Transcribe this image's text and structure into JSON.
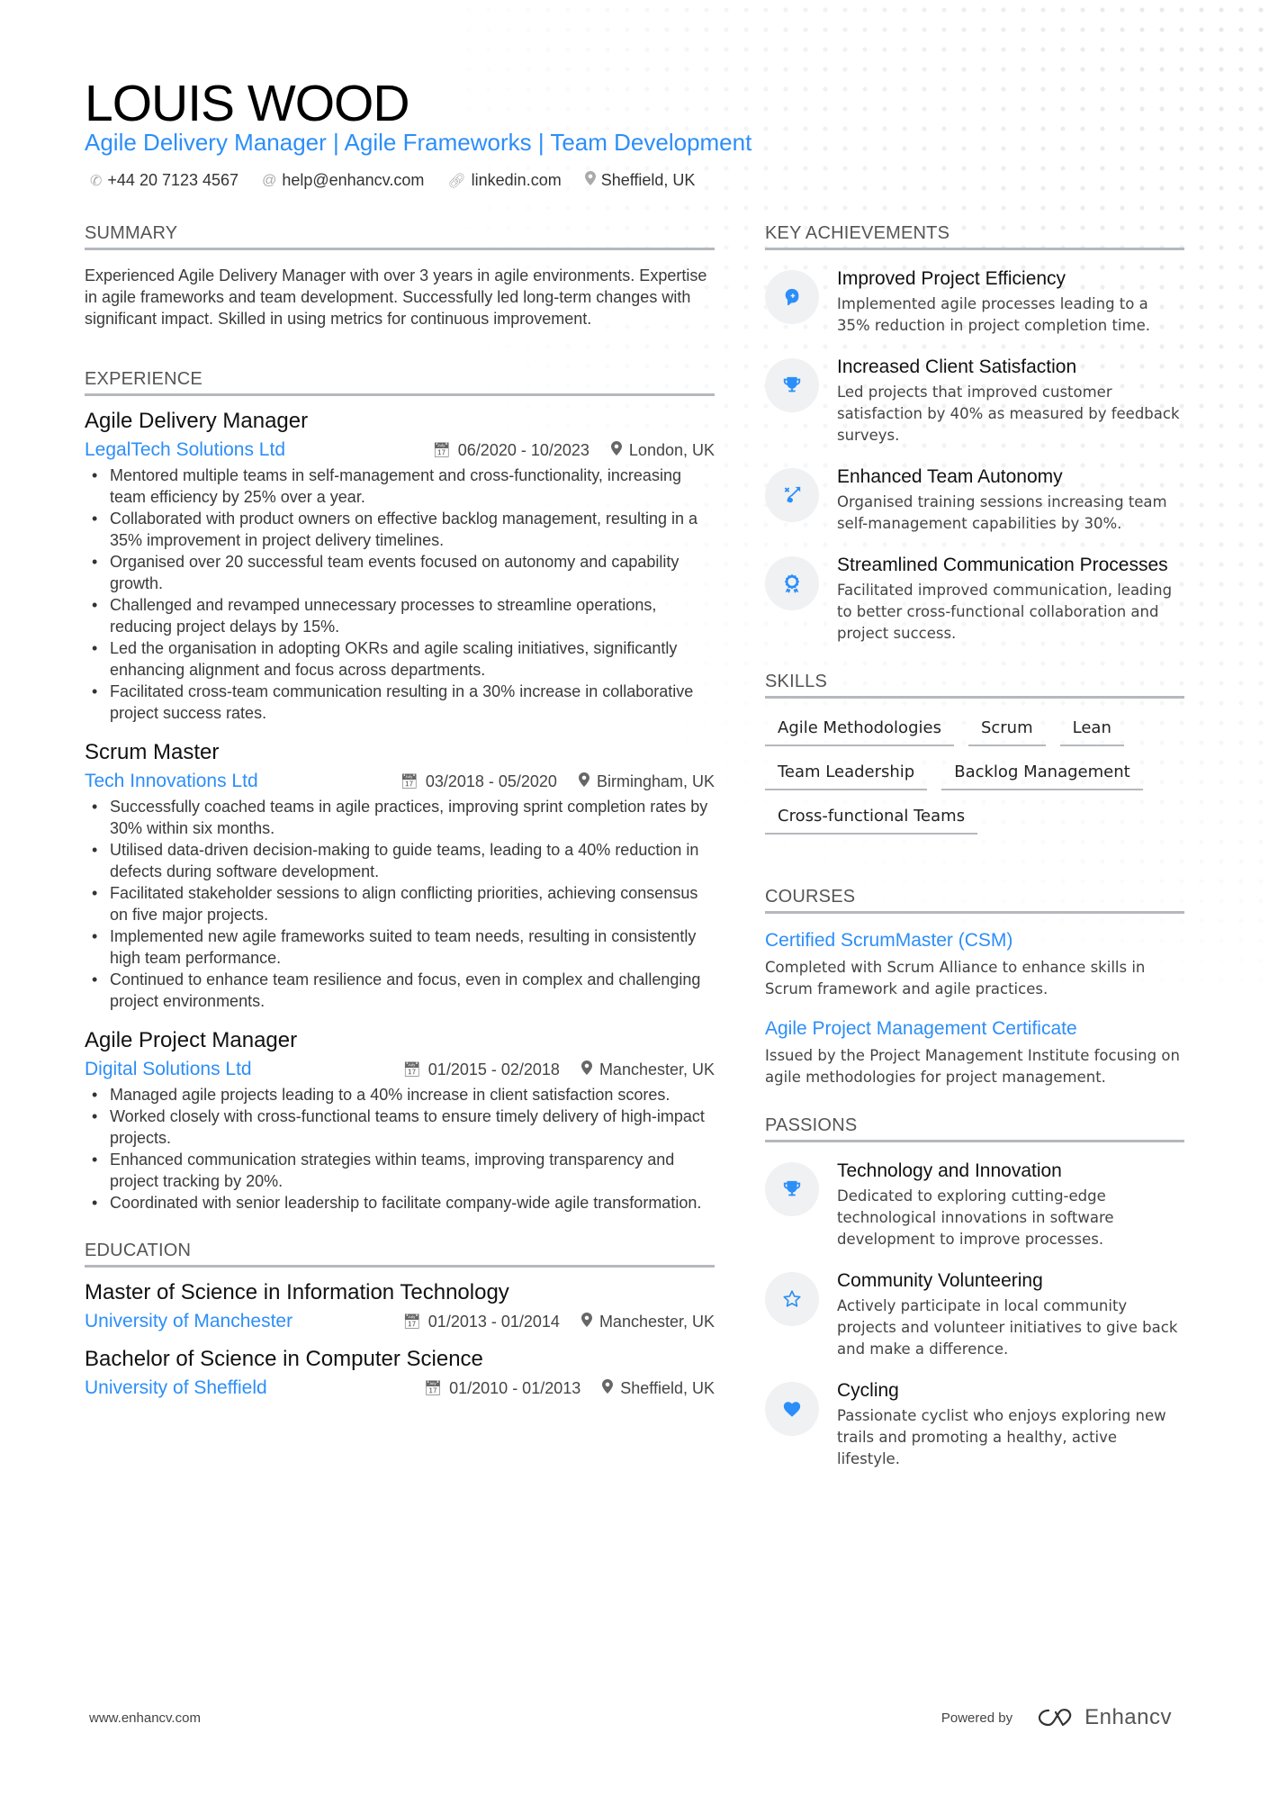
{
  "header": {
    "name": "LOUIS WOOD",
    "subtitle": "Agile Delivery Manager | Agile Frameworks | Team Development",
    "contacts": [
      {
        "icon": "phone-icon",
        "text": "+44 20 7123 4567"
      },
      {
        "icon": "at-icon",
        "text": "help@enhancv.com"
      },
      {
        "icon": "link-icon",
        "text": "linkedin.com"
      },
      {
        "icon": "location-pin-icon",
        "text": "Sheffield, UK"
      }
    ]
  },
  "summary": {
    "title": "SUMMARY",
    "text": "Experienced Agile Delivery Manager with over 3 years in agile environments. Expertise in agile frameworks and team development. Successfully led long-term changes with significant impact. Skilled in using metrics for continuous improvement."
  },
  "experience": {
    "title": "EXPERIENCE",
    "jobs": [
      {
        "title": "Agile Delivery Manager",
        "company": "LegalTech Solutions Ltd",
        "dates": "06/2020 - 10/2023",
        "location": "London, UK",
        "bullets": [
          "Mentored multiple teams in self-management and cross-functionality, increasing team efficiency by 25% over a year.",
          "Collaborated with product owners on effective backlog management, resulting in a 35% improvement in project delivery timelines.",
          "Organised over 20 successful team events focused on autonomy and capability growth.",
          "Challenged and revamped unnecessary processes to streamline operations, reducing project delays by 15%.",
          "Led the organisation in adopting OKRs and agile scaling initiatives, significantly enhancing alignment and focus across departments.",
          "Facilitated cross-team communication resulting in a 30% increase in collaborative project success rates."
        ]
      },
      {
        "title": "Scrum Master",
        "company": "Tech Innovations Ltd",
        "dates": "03/2018 - 05/2020",
        "location": "Birmingham, UK",
        "bullets": [
          "Successfully coached teams in agile practices, improving sprint completion rates by 30% within six months.",
          "Utilised data-driven decision-making to guide teams, leading to a 40% reduction in defects during software development.",
          "Facilitated stakeholder sessions to align conflicting priorities, achieving consensus on five major projects.",
          "Implemented new agile frameworks suited to team needs, resulting in consistently high team performance.",
          "Continued to enhance team resilience and focus, even in complex and challenging project environments."
        ]
      },
      {
        "title": "Agile Project Manager",
        "company": "Digital Solutions Ltd",
        "dates": "01/2015 - 02/2018",
        "location": "Manchester, UK",
        "bullets": [
          "Managed agile projects leading to a 40% increase in client satisfaction scores.",
          "Worked closely with cross-functional teams to ensure timely delivery of high-impact projects.",
          "Enhanced communication strategies within teams, improving transparency and project tracking by 20%.",
          "Coordinated with senior leadership to facilitate company-wide agile transformation."
        ]
      }
    ]
  },
  "education": {
    "title": "EDUCATION",
    "items": [
      {
        "degree": "Master of Science in Information Technology",
        "school": "University of Manchester",
        "dates": "01/2013 - 01/2014",
        "location": "Manchester, UK"
      },
      {
        "degree": "Bachelor of Science in Computer Science",
        "school": "University of Sheffield",
        "dates": "01/2010 - 01/2013",
        "location": "Sheffield, UK"
      }
    ]
  },
  "achievements": {
    "title": "KEY ACHIEVEMENTS",
    "items": [
      {
        "icon": "head-brain-icon",
        "title": "Improved Project Efficiency",
        "desc": "Implemented agile processes leading to a 35% reduction in project completion time."
      },
      {
        "icon": "trophy-icon",
        "title": "Increased Client Satisfaction",
        "desc": "Led projects that improved customer satisfaction by 40% as measured by feedback surveys."
      },
      {
        "icon": "strategy-arrow-icon",
        "title": "Enhanced Team Autonomy",
        "desc": "Organised training sessions increasing team self-management capabilities by 30%."
      },
      {
        "icon": "award-ribbon-icon",
        "title": "Streamlined Communication Processes",
        "desc": "Facilitated improved communication, leading to better cross-functional collaboration and project success."
      }
    ]
  },
  "skills": {
    "title": "SKILLS",
    "items": [
      "Agile Methodologies",
      "Scrum",
      "Lean",
      "Team Leadership",
      "Backlog Management",
      "Cross-functional Teams"
    ]
  },
  "courses": {
    "title": "COURSES",
    "items": [
      {
        "title": "Certified ScrumMaster (CSM)",
        "desc": "Completed with Scrum Alliance to enhance skills in Scrum framework and agile practices."
      },
      {
        "title": "Agile Project Management Certificate",
        "desc": "Issued by the Project Management Institute focusing on agile methodologies for project management."
      }
    ]
  },
  "passions": {
    "title": "PASSIONS",
    "items": [
      {
        "icon": "trophy-icon",
        "title": "Technology and Innovation",
        "desc": "Dedicated to exploring cutting-edge technological innovations in software development to improve processes."
      },
      {
        "icon": "star-outline-icon",
        "title": "Community Volunteering",
        "desc": "Actively participate in local community projects and volunteer initiatives to give back and make a difference."
      },
      {
        "icon": "heart-icon",
        "title": "Cycling",
        "desc": "Passionate cyclist who enjoys exploring new trails and promoting a healthy, active lifestyle."
      }
    ]
  },
  "footer": {
    "website": "www.enhancv.com",
    "powered_by": "Powered by",
    "brand": "Enhancv"
  },
  "colors": {
    "accent": "#2c8ef8",
    "divider": "#b5b8bc",
    "icon_bg": "#f0f1f2"
  }
}
